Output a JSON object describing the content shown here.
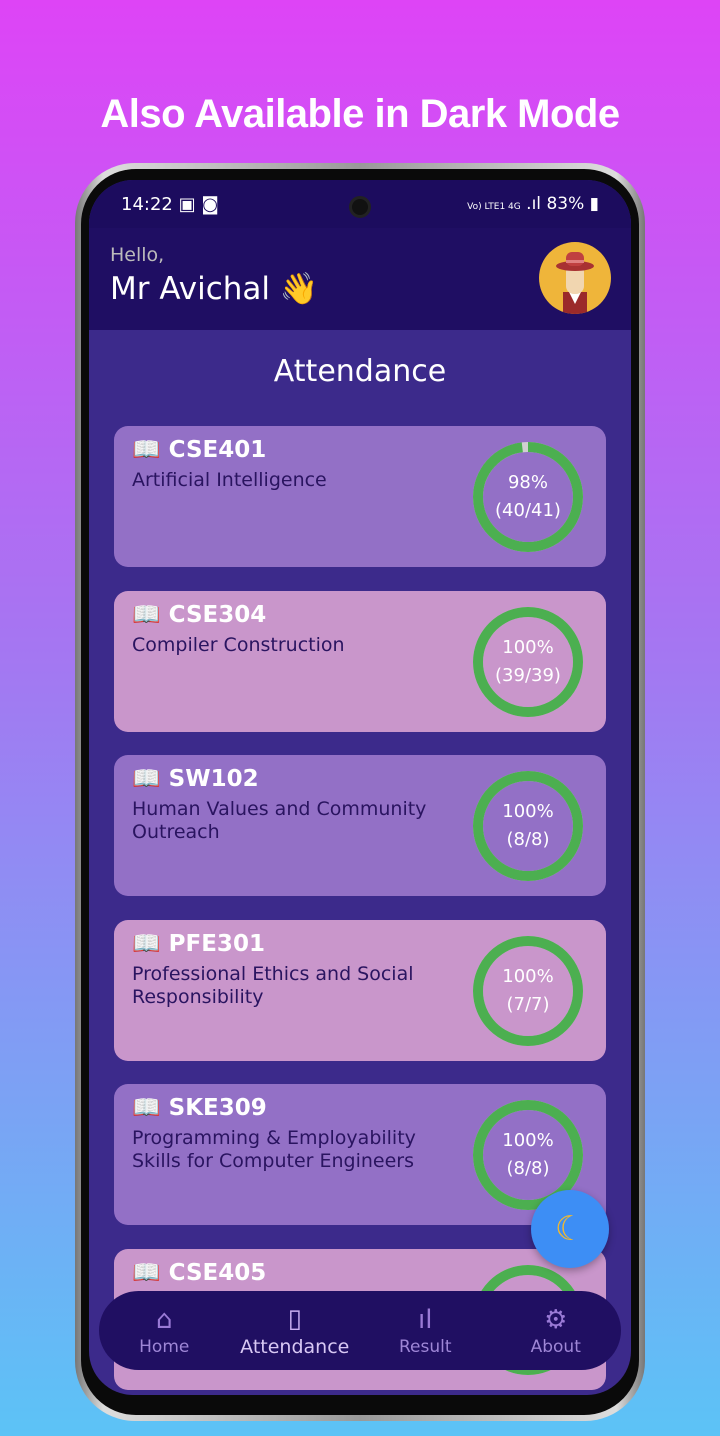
{
  "headline": "Also Available in Dark Mode",
  "status": {
    "time": "14:22",
    "network": "Vo) LTE1 4G",
    "battery": "83%"
  },
  "header": {
    "greeting": "Hello,",
    "name": "Mr Avichal 👋"
  },
  "title": "Attendance",
  "courses": [
    {
      "code": "CSE401",
      "name": "Artificial Intelligence",
      "percent": "98%",
      "count": "(40/41)",
      "fraction": 0.98,
      "color": "#9370c6"
    },
    {
      "code": "CSE304",
      "name": "Compiler Construction",
      "percent": "100%",
      "count": "(39/39)",
      "fraction": 1,
      "color": "#c996cb"
    },
    {
      "code": "SW102",
      "name": "Human Values and Community Outreach",
      "percent": "100%",
      "count": "(8/8)",
      "fraction": 1,
      "color": "#9370c6"
    },
    {
      "code": "PFE301",
      "name": "Professional Ethics and Social Responsibility",
      "percent": "100%",
      "count": "(7/7)",
      "fraction": 1,
      "color": "#c996cb"
    },
    {
      "code": "SKE309",
      "name": "Programming & Employability Skills for Computer Engineers",
      "percent": "100%",
      "count": "(8/8)",
      "fraction": 1,
      "color": "#9370c6"
    },
    {
      "code": "CSE405",
      "name": "",
      "percent": "",
      "count": "",
      "fraction": 1,
      "color": "#c996cb"
    }
  ],
  "book_icon": "📖",
  "fab_icon": "moon-icon",
  "nav": [
    {
      "label": "Home",
      "icon": "home-icon"
    },
    {
      "label": "Attendance",
      "icon": "book-icon"
    },
    {
      "label": "Result",
      "icon": "bar-chart-icon"
    },
    {
      "label": "About",
      "icon": "gear-icon"
    }
  ],
  "colors": {
    "ring": "#4caf50",
    "ring_track": "#d0d0d0"
  }
}
